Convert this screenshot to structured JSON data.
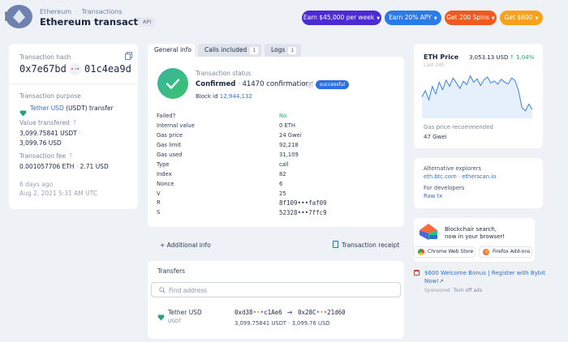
{
  "breadcrumb": [
    "Ethereum",
    "Transactions"
  ],
  "page_title": "Ethereum transaction",
  "api_label": "API",
  "promos": [
    {
      "label": "Earn $45,000 per week",
      "color": "#4b2bd6"
    },
    {
      "label": "Earn 20% APY",
      "color": "#2a7ae8"
    },
    {
      "label": "Get 200 Spins",
      "color": "#f05a22"
    },
    {
      "label": "Get $600",
      "color": "#f7a21a"
    }
  ],
  "summary": {
    "hash_label": "Transaction hash",
    "hash_start": "0x7e67bd",
    "hash_end": "01c4ea9d",
    "purpose_label": "Transaction purpose",
    "purpose_token": "Tether USD",
    "purpose_rest": "(USDT) transfer",
    "value_label": "Value transfered",
    "value_amount": "3,099.75841 USDT",
    "value_usd": "3,099.76 USD",
    "fee_label": "Transaction fee",
    "fee_eth": "0.001057706 ETH",
    "fee_usd": "2.71 USD",
    "age": "6 days ago",
    "date": "Aug 2, 2021 5:31 AM UTC"
  },
  "tabs": [
    {
      "label": "General info"
    },
    {
      "label": "Calls included",
      "count": "1"
    },
    {
      "label": "Logs",
      "count": "1"
    }
  ],
  "status": {
    "label": "Transaction status",
    "confirmed": "Confirmed",
    "confirmations": "41470 confirmations",
    "badge": "successful",
    "block_label": "Block id",
    "block_id": "12,944,132"
  },
  "details": [
    {
      "k": "Failed?",
      "v": "No"
    },
    {
      "k": "Internal value",
      "v": "0 ETH"
    },
    {
      "k": "Gas price",
      "v": "24 Gwei"
    },
    {
      "k": "Gas limit",
      "v": "92,218"
    },
    {
      "k": "Gas used",
      "v": "31,109"
    },
    {
      "k": "Type",
      "v": "call"
    },
    {
      "k": "Index",
      "v": "82"
    },
    {
      "k": "Nonce",
      "v": "6"
    },
    {
      "k": "V",
      "v": "25"
    },
    {
      "k": "R",
      "v": "8f109•••faf09"
    },
    {
      "k": "S",
      "v": "52328•••7ffc9"
    }
  ],
  "actions": {
    "additional": "+ Additional info",
    "receipt": "Transaction receipt"
  },
  "transfers": {
    "title": "Transfers",
    "search_placeholder": "Find address",
    "token": "Tether USD",
    "symbol": "USDT",
    "from": "0xd38",
    "from_end": "c1Ae6",
    "to": "0x28C",
    "to_end": "21d60",
    "amount": "3,099.75841 USDT",
    "amount_usd": "3,099.76 USD"
  },
  "price": {
    "title": "ETH Price",
    "value": "3,053.13 USD",
    "change": "↑ 1.04%",
    "range": "Last 24h",
    "gas_label": "Gas price recommended",
    "gas_value": "47 Gwei",
    "chart_data": {
      "type": "line",
      "values": [
        0.45,
        0.6,
        0.38,
        0.7,
        0.52,
        0.8,
        0.62,
        0.85,
        0.7,
        0.9,
        0.78,
        0.65,
        0.82,
        0.74,
        0.95,
        0.8,
        0.88,
        0.72,
        0.86,
        0.92,
        0.78,
        0.83,
        0.75,
        0.87,
        0.8,
        0.76,
        0.9,
        0.84,
        0.6,
        0.2,
        0.12,
        0.28,
        0.15
      ]
    }
  },
  "explorers": {
    "title": "Alternative explorers",
    "links": "eth.btc.com · etherscan.io",
    "dev_title": "For developers",
    "dev_link": "Raw tx"
  },
  "ad": {
    "text1": "Blockchair search,",
    "text2": "now in your browser!",
    "chrome": "Chrome Web Store",
    "firefox": "Firefox Add-ons",
    "bonus1": "$600 Welcome Bonus | Register with Bybit",
    "bonus2": "Now!↗",
    "sponsored": "Sponsored",
    "turn_off": "Turn off ads"
  }
}
